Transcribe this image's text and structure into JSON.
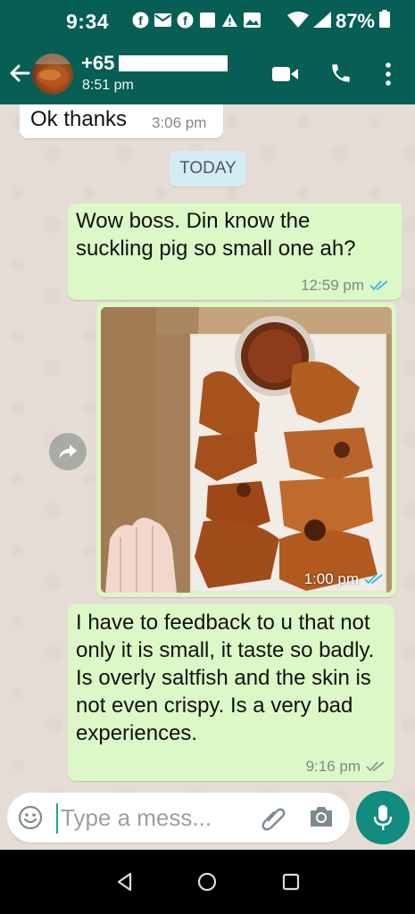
{
  "status_bar": {
    "time": "9:34",
    "battery": "87%"
  },
  "header": {
    "contact_name": "+65",
    "last_seen": "8:51 pm"
  },
  "messages": [
    {
      "direction": "in",
      "text": "Ok thanks",
      "time": "3:06 pm"
    },
    {
      "direction": "out",
      "text": "Wow boss. Din know the suckling pig so small one ah?",
      "time": "12:59 pm",
      "status": "read"
    },
    {
      "direction": "out",
      "type": "image",
      "time": "1:00 pm",
      "status": "read"
    },
    {
      "direction": "out",
      "text": "I have to feedback to u that not only it is small, it taste so badly. Is overly saltfish and the skin is not even crispy. Is a very bad experiences.",
      "time": "9:16 pm",
      "status": "delivered"
    }
  ],
  "date_divider": "TODAY",
  "composer": {
    "placeholder": "Type a mess..."
  },
  "colors": {
    "header": "#075e54",
    "outgoing_bubble": "#dcf8c6",
    "chat_bg": "#e5ddd5",
    "fab": "#128c7e"
  },
  "icons": [
    "back-icon",
    "video-call-icon",
    "phone-icon",
    "more-menu-icon",
    "forward-icon",
    "emoji-icon",
    "attach-icon",
    "camera-icon",
    "mic-icon"
  ]
}
